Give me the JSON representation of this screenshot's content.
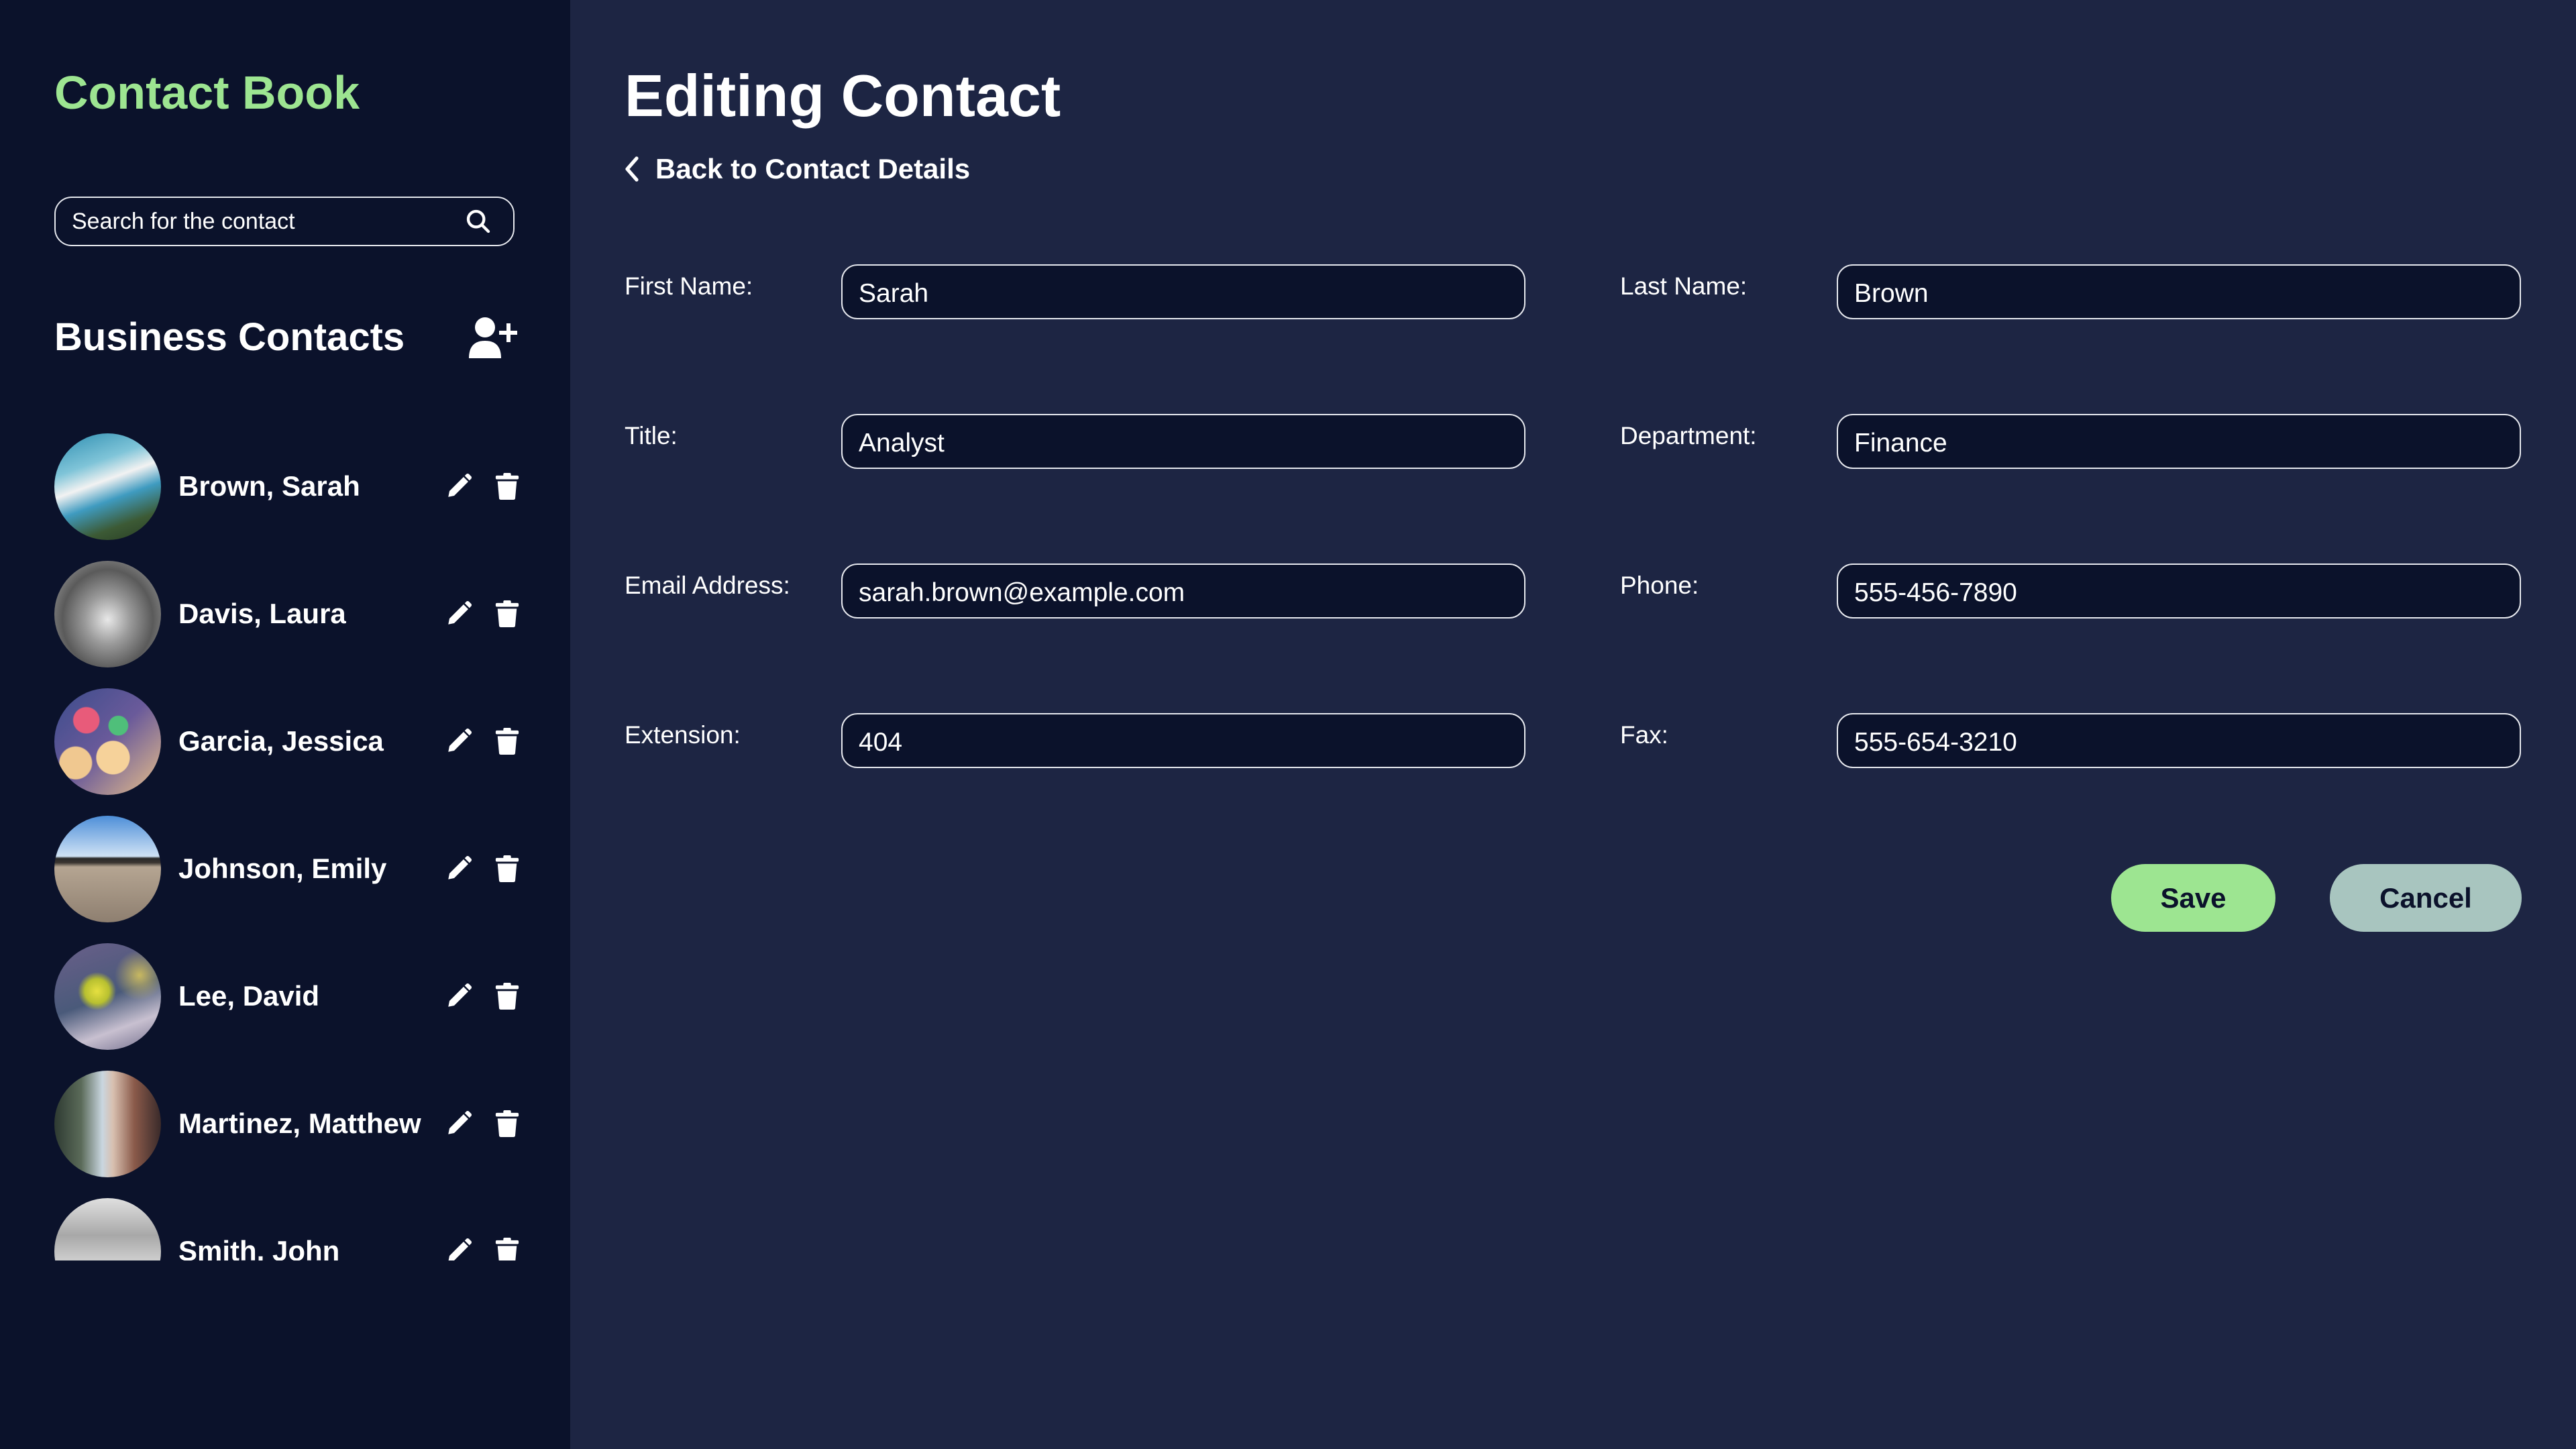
{
  "sidebar": {
    "app_title": "Contact Book",
    "search": {
      "placeholder": "Search for the contact",
      "value": "",
      "icon": "search-icon"
    },
    "section_title": "Business Contacts",
    "add_contact_icon": "user-plus-icon",
    "contacts": [
      {
        "name": "Brown, Sarah",
        "avatar": "sky-clouds-tree",
        "edit_icon": "pencil-icon",
        "delete_icon": "trash-icon"
      },
      {
        "name": "Davis, Laura",
        "avatar": "lighthouse-bw",
        "edit_icon": "pencil-icon",
        "delete_icon": "trash-icon"
      },
      {
        "name": "Garcia, Jessica",
        "avatar": "bokeh-lights",
        "edit_icon": "pencil-icon",
        "delete_icon": "trash-icon"
      },
      {
        "name": "Johnson, Emily",
        "avatar": "beach-horizon",
        "edit_icon": "pencil-icon",
        "delete_icon": "trash-icon"
      },
      {
        "name": "Lee, David",
        "avatar": "yellow-flower",
        "edit_icon": "pencil-icon",
        "delete_icon": "trash-icon"
      },
      {
        "name": "Martinez, Matthew",
        "avatar": "city-street",
        "edit_icon": "pencil-icon",
        "delete_icon": "trash-icon"
      },
      {
        "name": "Smith, John",
        "avatar": "cloudy-sky-bw",
        "edit_icon": "pencil-icon",
        "delete_icon": "trash-icon"
      }
    ]
  },
  "main": {
    "title": "Editing Contact",
    "back_link": "Back to Contact Details",
    "form": {
      "first_name": {
        "label": "First Name:",
        "value": "Sarah"
      },
      "last_name": {
        "label": "Last Name:",
        "value": "Brown"
      },
      "title": {
        "label": "Title:",
        "value": "Analyst"
      },
      "department": {
        "label": "Department:",
        "value": "Finance"
      },
      "email": {
        "label": "Email Address:",
        "value": "sarah.brown@example.com"
      },
      "phone": {
        "label": "Phone:",
        "value": "555-456-7890"
      },
      "extension": {
        "label": "Extension:",
        "value": "404"
      },
      "fax": {
        "label": "Fax:",
        "value": "555-654-3210"
      }
    },
    "buttons": {
      "save": "Save",
      "cancel": "Cancel"
    }
  },
  "colors": {
    "sidebar_bg": "#0b122b",
    "main_bg": "#1d2543",
    "accent_green": "#9de591",
    "cancel_gray": "#a8c5bf",
    "text": "#ffffff"
  }
}
